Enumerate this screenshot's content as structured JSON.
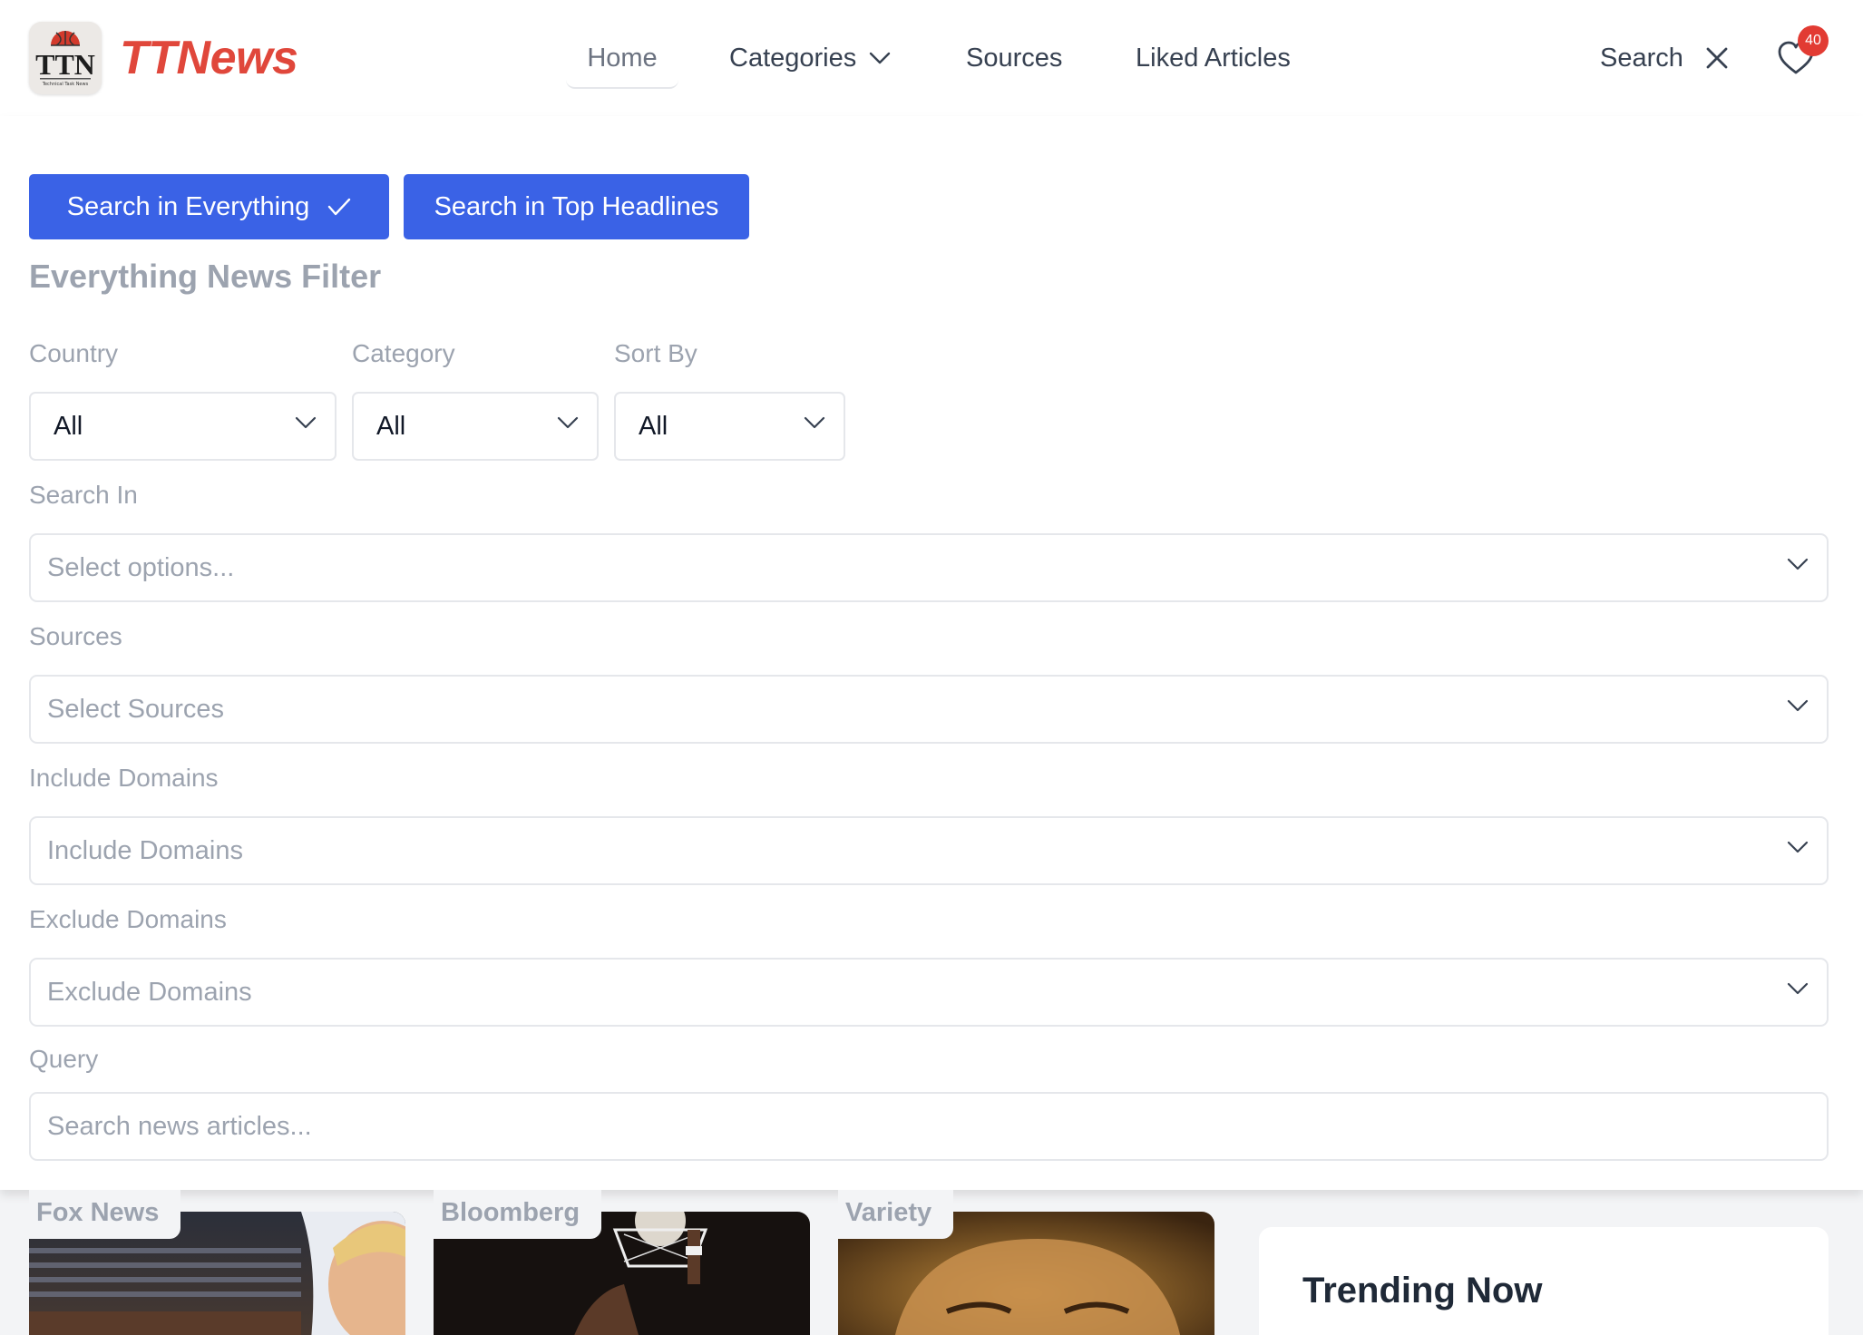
{
  "header": {
    "brand": "TTNews",
    "logo_alt": "Technical Task News",
    "nav": {
      "home": "Home",
      "categories": "Categories",
      "sources": "Sources",
      "liked": "Liked Articles"
    },
    "search_label": "Search",
    "liked_count": "40"
  },
  "filter": {
    "mode_everything": "Search in Everything",
    "mode_headlines": "Search in Top Headlines",
    "title": "Everything News Filter",
    "country": {
      "label": "Country",
      "value": "All"
    },
    "category": {
      "label": "Category",
      "value": "All"
    },
    "sort_by": {
      "label": "Sort By",
      "value": "All"
    },
    "search_in": {
      "label": "Search In",
      "placeholder": "Select options..."
    },
    "sources": {
      "label": "Sources",
      "placeholder": "Select Sources"
    },
    "include_domains": {
      "label": "Include Domains",
      "placeholder": "Include Domains"
    },
    "exclude_domains": {
      "label": "Exclude Domains",
      "placeholder": "Exclude Domains"
    },
    "query": {
      "label": "Query",
      "placeholder": "Search news articles..."
    }
  },
  "articles": [
    {
      "source": "Fox News"
    },
    {
      "source": "Bloomberg"
    },
    {
      "source": "Variety"
    }
  ],
  "trending": {
    "title": "Trending Now"
  },
  "colors": {
    "brand": "#e0473b",
    "primary_button": "#3a62e6",
    "badge": "#e23b33"
  },
  "icons": {
    "categories": "chevron-down-icon",
    "close": "close-icon",
    "liked": "heart-icon",
    "mode_selected": "check-icon"
  }
}
